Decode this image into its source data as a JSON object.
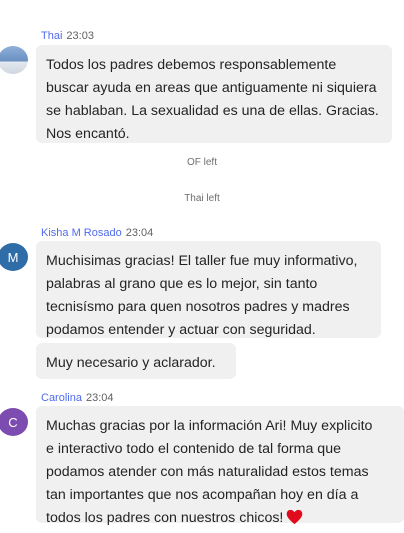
{
  "messages": [
    {
      "sender": "Thai",
      "time": "23:03",
      "bubbles": [
        "Todos los padres debemos responsablemente\nbuscar ayuda en areas que antiguamente ni siquiera\nse hablaban. La sexualidad es una de ellas. Gracias.\nNos encantó."
      ]
    },
    {
      "sender": "Kisha M Rosado",
      "time": "23:04",
      "avatar_initial": "M",
      "bubbles": [
        "Muchisimas gracias! El taller fue muy informativo,\npalabras al grano que es lo mejor, sin tanto\ntecnisísmo para  quen nosotros padres y madres\npodamos entender y actuar con seguridad.",
        "Muy necesario y aclarador."
      ]
    },
    {
      "sender": "Carolina",
      "time": "23:04",
      "avatar_initial": "C",
      "bubbles": [
        "Muchas gracias por la información Ari! Muy explicito\ne interactivo todo el contenido de tal forma que\npodamos atender con más naturalidad estos temas\ntan importantes que nos acompañan hoy en día a\ntodos los padres con nuestros chicos!"
      ]
    }
  ],
  "system_notices": [
    "OF left",
    "Thai left"
  ],
  "icons": {
    "reaction": "heart-icon",
    "accent": "#e00b1c"
  },
  "colors": {
    "sender_name": "#4f6bed",
    "bubble_bg": "#f0f0f0"
  }
}
